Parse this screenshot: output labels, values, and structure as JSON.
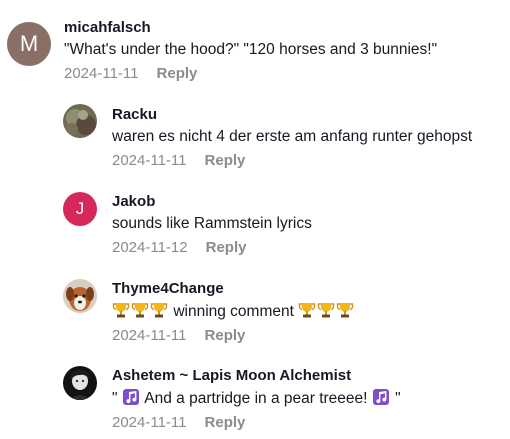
{
  "comments": [
    {
      "username": "micahfalsch",
      "avatar_letter": "M",
      "avatar_color": "#8a6f67",
      "text": "\"What's under the hood?\" \"120 horses and 3 bunnies!\"",
      "date": "2024-11-11",
      "reply_label": "Reply"
    }
  ],
  "replies": [
    {
      "username": "Racku",
      "avatar_icon": "photo-avatar",
      "text": "waren es nicht 4 der erste am anfang runter gehopst",
      "date": "2024-11-11",
      "reply_label": "Reply"
    },
    {
      "username": "Jakob",
      "avatar_letter": "J",
      "avatar_color": "#d6275b",
      "text": "sounds like Rammstein lyrics",
      "date": "2024-11-12",
      "reply_label": "Reply"
    },
    {
      "username": "Thyme4Change",
      "avatar_icon": "dog-photo-avatar",
      "text": "winning comment",
      "emoji_icon": "trophy-icon",
      "date": "2024-11-11",
      "reply_label": "Reply"
    },
    {
      "username": "Ashetem ~ Lapis Moon Alchemist",
      "avatar_icon": "dark-photo-avatar",
      "text_before": "\"",
      "text_middle": " And a partridge in a pear treeee! ",
      "text_after": "\"",
      "emoji_icon": "music-notes-icon",
      "date": "2024-11-11",
      "reply_label": "Reply"
    }
  ]
}
